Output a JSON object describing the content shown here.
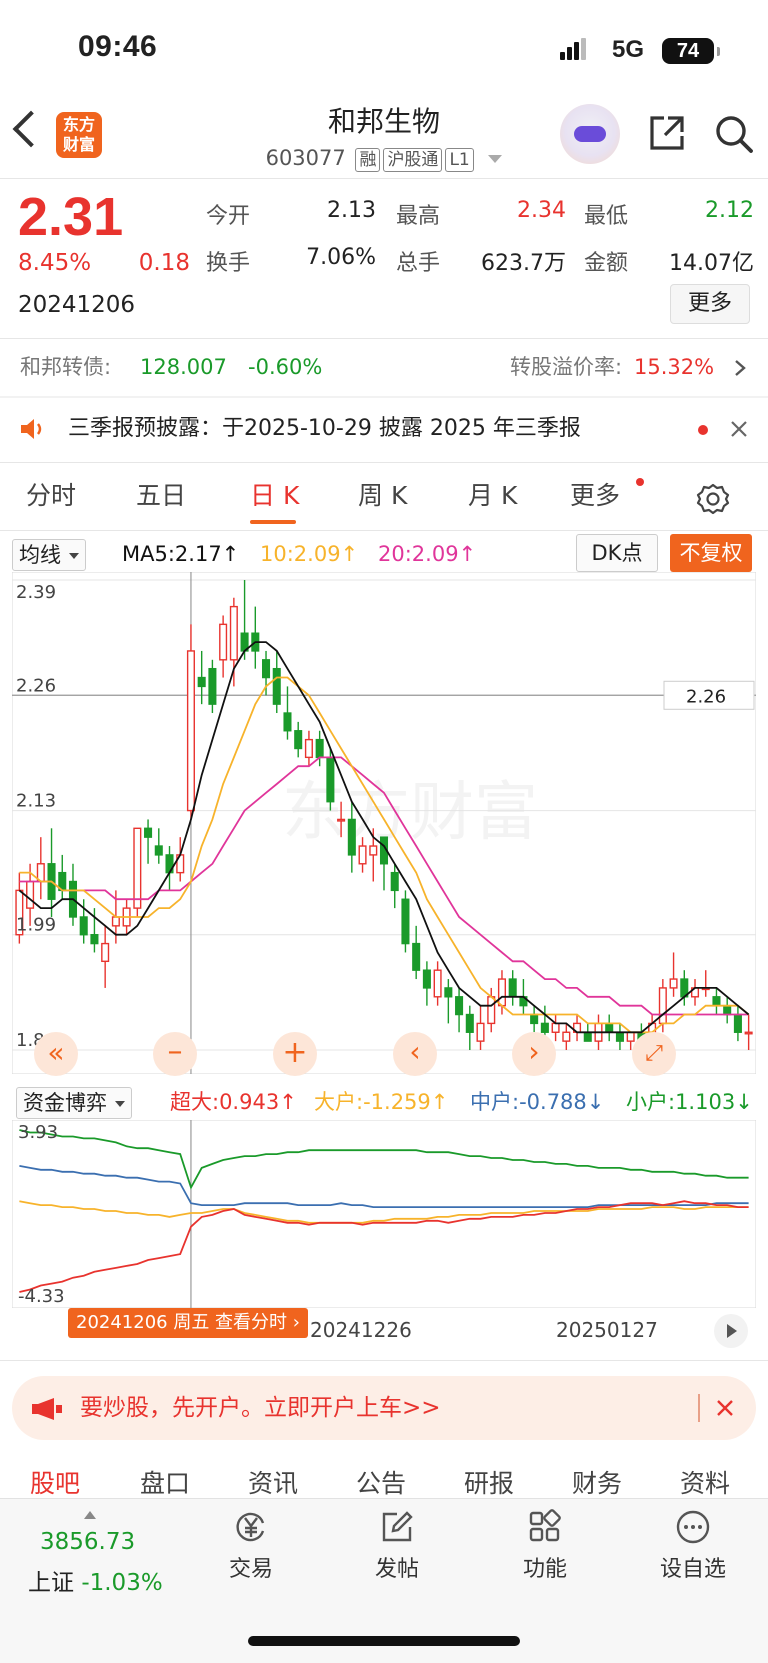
{
  "status_bar": {
    "time": "09:46",
    "network": "5G",
    "battery": "74"
  },
  "header": {
    "logo_text": "东方财富",
    "stock_name": "和邦生物",
    "stock_code": "603077",
    "tags": [
      "融",
      "沪股通",
      "L1"
    ]
  },
  "quote": {
    "price": "2.31",
    "change_pct": "8.45%",
    "change_amt": "0.18",
    "date": "20241206",
    "fields": [
      {
        "label": "今开",
        "value": "2.13",
        "color": "neutral"
      },
      {
        "label": "最高",
        "value": "2.34",
        "color": "red"
      },
      {
        "label": "最低",
        "value": "2.12",
        "color": "green"
      },
      {
        "label": "换手",
        "value": "7.06%",
        "color": "neutral"
      },
      {
        "label": "总手",
        "value": "623.7万",
        "color": "neutral"
      },
      {
        "label": "金额",
        "value": "14.07亿",
        "color": "neutral"
      }
    ],
    "more_label": "更多"
  },
  "bond": {
    "label": "和邦转债:",
    "price": "128.007",
    "change": "-0.60%",
    "premium_label": "转股溢价率:",
    "premium_value": "15.32%"
  },
  "notice": {
    "text": "三季报预披露：于2025-10-29 披露 2025 年三季报"
  },
  "chart_tabs": {
    "items": [
      "分时",
      "五日",
      "日 K",
      "周 K",
      "月 K",
      "更多"
    ],
    "active": "日 K"
  },
  "ma_bar": {
    "selector": "均线",
    "ma5": "MA5:2.17↑",
    "ma10": "10:2.09↑",
    "ma20": "20:2.09↑",
    "dk_label": "DK点",
    "fq_label": "不复权"
  },
  "kline_axis": {
    "labels": [
      "2.39",
      "2.26",
      "2.13",
      "1.99",
      "1.86"
    ],
    "crosshair_price": "2.26"
  },
  "fund_bar": {
    "selector": "资金博弈",
    "super": "超大:0.943↑",
    "large": "大户:-1.259↑",
    "medium": "中户:-0.788↓",
    "small": "小户:1.103↓"
  },
  "fund_axis": {
    "top": "3.93",
    "bottom": "-4.33"
  },
  "date_axis": {
    "labels": [
      "20241226",
      "20250127"
    ],
    "badge": "20241206 周五 查看分时"
  },
  "watermark": "东方财富",
  "colors": {
    "up": "#e8332e",
    "down": "#1a9a2a",
    "accent": "#f0641e",
    "ma5": "#111111",
    "ma10": "#f7b32b",
    "ma20": "#e0359a"
  },
  "chart_data": {
    "type": "candlestick",
    "ylim": [
      1.86,
      2.39
    ],
    "candles": [
      {
        "o": 1.99,
        "h": 2.06,
        "l": 1.98,
        "c": 2.04
      },
      {
        "o": 2.02,
        "h": 2.07,
        "l": 2.0,
        "c": 2.05
      },
      {
        "o": 2.05,
        "h": 2.1,
        "l": 2.03,
        "c": 2.07
      },
      {
        "o": 2.07,
        "h": 2.11,
        "l": 2.01,
        "c": 2.03
      },
      {
        "o": 2.06,
        "h": 2.08,
        "l": 2.03,
        "c": 2.04
      },
      {
        "o": 2.05,
        "h": 2.07,
        "l": 2.0,
        "c": 2.01
      },
      {
        "o": 2.01,
        "h": 2.03,
        "l": 1.98,
        "c": 1.99
      },
      {
        "o": 1.99,
        "h": 2.02,
        "l": 1.97,
        "c": 1.98
      },
      {
        "o": 1.96,
        "h": 2.0,
        "l": 1.93,
        "c": 1.98
      },
      {
        "o": 2.0,
        "h": 2.04,
        "l": 1.98,
        "c": 2.01
      },
      {
        "o": 2.0,
        "h": 2.03,
        "l": 1.99,
        "c": 2.02
      },
      {
        "o": 2.02,
        "h": 2.11,
        "l": 2.01,
        "c": 2.11
      },
      {
        "o": 2.11,
        "h": 2.12,
        "l": 2.07,
        "c": 2.1
      },
      {
        "o": 2.09,
        "h": 2.11,
        "l": 2.07,
        "c": 2.08
      },
      {
        "o": 2.08,
        "h": 2.09,
        "l": 2.04,
        "c": 2.06
      },
      {
        "o": 2.06,
        "h": 2.1,
        "l": 2.05,
        "c": 2.08
      },
      {
        "o": 2.13,
        "h": 2.34,
        "l": 2.12,
        "c": 2.31
      },
      {
        "o": 2.28,
        "h": 2.31,
        "l": 2.25,
        "c": 2.27
      },
      {
        "o": 2.29,
        "h": 2.3,
        "l": 2.24,
        "c": 2.25
      },
      {
        "o": 2.3,
        "h": 2.35,
        "l": 2.28,
        "c": 2.34
      },
      {
        "o": 2.3,
        "h": 2.37,
        "l": 2.27,
        "c": 2.36
      },
      {
        "o": 2.33,
        "h": 2.39,
        "l": 2.3,
        "c": 2.31
      },
      {
        "o": 2.33,
        "h": 2.36,
        "l": 2.29,
        "c": 2.31
      },
      {
        "o": 2.3,
        "h": 2.31,
        "l": 2.26,
        "c": 2.28
      },
      {
        "o": 2.29,
        "h": 2.31,
        "l": 2.24,
        "c": 2.25
      },
      {
        "o": 2.24,
        "h": 2.27,
        "l": 2.21,
        "c": 2.22
      },
      {
        "o": 2.22,
        "h": 2.23,
        "l": 2.19,
        "c": 2.2
      },
      {
        "o": 2.19,
        "h": 2.22,
        "l": 2.18,
        "c": 2.21
      },
      {
        "o": 2.21,
        "h": 2.22,
        "l": 2.18,
        "c": 2.19
      },
      {
        "o": 2.19,
        "h": 2.2,
        "l": 2.13,
        "c": 2.14
      },
      {
        "o": 2.12,
        "h": 2.14,
        "l": 2.1,
        "c": 2.12
      },
      {
        "o": 2.12,
        "h": 2.14,
        "l": 2.06,
        "c": 2.08
      },
      {
        "o": 2.07,
        "h": 2.1,
        "l": 2.06,
        "c": 2.09
      },
      {
        "o": 2.08,
        "h": 2.11,
        "l": 2.05,
        "c": 2.09
      },
      {
        "o": 2.1,
        "h": 2.1,
        "l": 2.04,
        "c": 2.07
      },
      {
        "o": 2.06,
        "h": 2.07,
        "l": 2.02,
        "c": 2.04
      },
      {
        "o": 2.03,
        "h": 2.04,
        "l": 1.97,
        "c": 1.98
      },
      {
        "o": 1.98,
        "h": 2.0,
        "l": 1.94,
        "c": 1.95
      },
      {
        "o": 1.95,
        "h": 1.96,
        "l": 1.91,
        "c": 1.93
      },
      {
        "o": 1.92,
        "h": 1.96,
        "l": 1.91,
        "c": 1.95
      },
      {
        "o": 1.93,
        "h": 1.94,
        "l": 1.89,
        "c": 1.92
      },
      {
        "o": 1.92,
        "h": 1.93,
        "l": 1.88,
        "c": 1.9
      },
      {
        "o": 1.9,
        "h": 1.91,
        "l": 1.86,
        "c": 1.88
      },
      {
        "o": 1.87,
        "h": 1.91,
        "l": 1.86,
        "c": 1.89
      },
      {
        "o": 1.89,
        "h": 1.93,
        "l": 1.88,
        "c": 1.92
      },
      {
        "o": 1.91,
        "h": 1.95,
        "l": 1.9,
        "c": 1.94
      },
      {
        "o": 1.94,
        "h": 1.95,
        "l": 1.91,
        "c": 1.92
      },
      {
        "o": 1.92,
        "h": 1.94,
        "l": 1.9,
        "c": 1.91
      },
      {
        "o": 1.9,
        "h": 1.91,
        "l": 1.88,
        "c": 1.89
      },
      {
        "o": 1.89,
        "h": 1.91,
        "l": 1.87,
        "c": 1.88
      },
      {
        "o": 1.88,
        "h": 1.9,
        "l": 1.87,
        "c": 1.89
      },
      {
        "o": 1.87,
        "h": 1.89,
        "l": 1.86,
        "c": 1.88
      },
      {
        "o": 1.88,
        "h": 1.9,
        "l": 1.87,
        "c": 1.89
      },
      {
        "o": 1.88,
        "h": 1.89,
        "l": 1.87,
        "c": 1.87
      },
      {
        "o": 1.87,
        "h": 1.9,
        "l": 1.86,
        "c": 1.89
      },
      {
        "o": 1.89,
        "h": 1.9,
        "l": 1.87,
        "c": 1.88
      },
      {
        "o": 1.88,
        "h": 1.89,
        "l": 1.86,
        "c": 1.87
      },
      {
        "o": 1.87,
        "h": 1.88,
        "l": 1.86,
        "c": 1.88
      },
      {
        "o": 1.88,
        "h": 1.89,
        "l": 1.86,
        "c": 1.87
      },
      {
        "o": 1.87,
        "h": 1.9,
        "l": 1.87,
        "c": 1.89
      },
      {
        "o": 1.89,
        "h": 1.94,
        "l": 1.88,
        "c": 1.93
      },
      {
        "o": 1.93,
        "h": 1.97,
        "l": 1.92,
        "c": 1.94
      },
      {
        "o": 1.94,
        "h": 1.95,
        "l": 1.91,
        "c": 1.92
      },
      {
        "o": 1.92,
        "h": 1.94,
        "l": 1.91,
        "c": 1.93
      },
      {
        "o": 1.93,
        "h": 1.95,
        "l": 1.92,
        "c": 1.93
      },
      {
        "o": 1.92,
        "h": 1.93,
        "l": 1.9,
        "c": 1.91
      },
      {
        "o": 1.91,
        "h": 1.92,
        "l": 1.89,
        "c": 1.9
      },
      {
        "o": 1.9,
        "h": 1.91,
        "l": 1.87,
        "c": 1.88
      },
      {
        "o": 1.88,
        "h": 1.9,
        "l": 1.86,
        "c": 1.88
      }
    ],
    "ma5": [
      2.04,
      2.03,
      2.02,
      2.02,
      2.03,
      2.03,
      2.02,
      2.01,
      2.0,
      1.99,
      1.99,
      2.0,
      2.02,
      2.04,
      2.06,
      2.08,
      2.12,
      2.17,
      2.21,
      2.25,
      2.29,
      2.31,
      2.32,
      2.32,
      2.31,
      2.29,
      2.27,
      2.25,
      2.23,
      2.2,
      2.17,
      2.14,
      2.12,
      2.1,
      2.09,
      2.07,
      2.05,
      2.03,
      2.0,
      1.97,
      1.95,
      1.93,
      1.92,
      1.91,
      1.91,
      1.92,
      1.92,
      1.92,
      1.91,
      1.9,
      1.89,
      1.89,
      1.88,
      1.88,
      1.88,
      1.88,
      1.88,
      1.88,
      1.88,
      1.89,
      1.9,
      1.91,
      1.92,
      1.93,
      1.93,
      1.93,
      1.92,
      1.91,
      1.9
    ],
    "ma10": [
      2.06,
      2.06,
      2.05,
      2.05,
      2.04,
      2.04,
      2.04,
      2.03,
      2.02,
      2.01,
      2.01,
      2.01,
      2.01,
      2.02,
      2.02,
      2.03,
      2.05,
      2.09,
      2.12,
      2.16,
      2.19,
      2.22,
      2.25,
      2.27,
      2.28,
      2.28,
      2.27,
      2.26,
      2.24,
      2.22,
      2.2,
      2.18,
      2.16,
      2.14,
      2.12,
      2.1,
      2.08,
      2.06,
      2.03,
      2.01,
      1.99,
      1.97,
      1.95,
      1.93,
      1.92,
      1.91,
      1.9,
      1.9,
      1.9,
      1.9,
      1.9,
      1.9,
      1.9,
      1.89,
      1.89,
      1.89,
      1.89,
      1.88,
      1.88,
      1.88,
      1.89,
      1.89,
      1.9,
      1.9,
      1.91,
      1.91,
      1.91,
      1.91,
      1.9
    ],
    "ma20": [
      2.05,
      2.05,
      2.05,
      2.05,
      2.04,
      2.04,
      2.04,
      2.04,
      2.04,
      2.03,
      2.03,
      2.03,
      2.03,
      2.04,
      2.04,
      2.04,
      2.05,
      2.06,
      2.07,
      2.09,
      2.11,
      2.13,
      2.14,
      2.15,
      2.16,
      2.17,
      2.18,
      2.18,
      2.19,
      2.19,
      2.19,
      2.18,
      2.17,
      2.16,
      2.15,
      2.13,
      2.11,
      2.09,
      2.07,
      2.05,
      2.03,
      2.01,
      2.0,
      1.99,
      1.98,
      1.97,
      1.96,
      1.96,
      1.95,
      1.94,
      1.94,
      1.93,
      1.93,
      1.92,
      1.92,
      1.92,
      1.91,
      1.91,
      1.91,
      1.9,
      1.9,
      1.9,
      1.9,
      1.9,
      1.9,
      1.9,
      1.9,
      1.9,
      1.9
    ],
    "fund_series": {
      "ylim": [
        -4.33,
        3.93
      ],
      "super": [
        -4.33,
        -4.2,
        -4.0,
        -3.9,
        -3.8,
        -3.6,
        -3.5,
        -3.3,
        -3.2,
        -3.1,
        -3.0,
        -2.9,
        -2.7,
        -2.6,
        -2.5,
        -2.4,
        -1.0,
        -0.5,
        -0.4,
        -0.2,
        -0.1,
        -0.4,
        -0.5,
        -0.6,
        -0.7,
        -0.8,
        -0.8,
        -0.9,
        -0.8,
        -0.8,
        -0.8,
        -0.8,
        -0.9,
        -0.8,
        -0.8,
        -0.8,
        -0.8,
        -0.8,
        -0.7,
        -0.7,
        -0.8,
        -0.7,
        -0.6,
        -0.6,
        -0.5,
        -0.5,
        -0.5,
        -0.4,
        -0.4,
        -0.3,
        -0.3,
        -0.2,
        -0.1,
        -0.1,
        0.0,
        0.0,
        0.1,
        0.2,
        0.2,
        0.2,
        0.1,
        0.2,
        0.3,
        0.2,
        0.2,
        0.1,
        0.1,
        0.0,
        0.0
      ],
      "large": [
        0.3,
        0.2,
        0.1,
        0.1,
        0.0,
        0.0,
        -0.1,
        -0.1,
        -0.2,
        -0.2,
        -0.3,
        -0.3,
        -0.4,
        -0.4,
        -0.5,
        -0.4,
        -0.3,
        -0.3,
        -0.2,
        -0.1,
        -0.1,
        -0.3,
        -0.4,
        -0.5,
        -0.6,
        -0.7,
        -0.7,
        -0.8,
        -0.8,
        -0.8,
        -0.8,
        -0.8,
        -0.8,
        -0.7,
        -0.7,
        -0.6,
        -0.6,
        -0.6,
        -0.6,
        -0.5,
        -0.5,
        -0.4,
        -0.4,
        -0.4,
        -0.3,
        -0.3,
        -0.3,
        -0.3,
        -0.2,
        -0.2,
        -0.2,
        -0.2,
        -0.2,
        -0.2,
        -0.1,
        -0.1,
        -0.1,
        -0.1,
        -0.1,
        0.0,
        0.0,
        0.0,
        -0.1,
        -0.1,
        0.0,
        0.0,
        0.0,
        0.0,
        0.0
      ],
      "medium": [
        2.1,
        2.0,
        1.9,
        1.9,
        1.8,
        1.8,
        1.7,
        1.7,
        1.6,
        1.6,
        1.5,
        1.5,
        1.4,
        1.3,
        1.3,
        1.2,
        0.2,
        0.1,
        0.1,
        0.1,
        0.1,
        0.2,
        0.2,
        0.2,
        0.2,
        0.2,
        0.1,
        0.1,
        0.1,
        0.1,
        0.2,
        0.1,
        0.1,
        0.0,
        0.0,
        0.0,
        0.0,
        0.0,
        0.0,
        0.0,
        0.0,
        0.0,
        0.0,
        0.0,
        0.0,
        0.0,
        0.0,
        0.0,
        0.0,
        0.0,
        0.0,
        0.0,
        0.0,
        0.0,
        0.1,
        0.1,
        0.1,
        0.1,
        0.1,
        0.1,
        0.1,
        0.1,
        0.1,
        0.1,
        0.1,
        0.2,
        0.2,
        0.2,
        0.2
      ],
      "small": [
        3.93,
        3.8,
        3.8,
        3.7,
        3.6,
        3.6,
        3.5,
        3.5,
        3.4,
        3.3,
        3.1,
        3.0,
        3.0,
        2.9,
        2.8,
        2.7,
        1.0,
        2.0,
        2.2,
        2.4,
        2.5,
        2.6,
        2.6,
        2.7,
        2.7,
        2.8,
        2.8,
        2.9,
        2.9,
        2.9,
        2.9,
        2.9,
        2.9,
        2.9,
        2.9,
        2.9,
        2.9,
        2.9,
        2.8,
        2.8,
        2.8,
        2.7,
        2.6,
        2.6,
        2.5,
        2.5,
        2.4,
        2.4,
        2.3,
        2.3,
        2.2,
        2.2,
        2.1,
        2.1,
        2.0,
        2.0,
        2.0,
        1.9,
        1.9,
        1.8,
        1.8,
        1.8,
        1.7,
        1.7,
        1.6,
        1.6,
        1.5,
        1.5,
        1.5
      ]
    }
  },
  "promo": {
    "text": "要炒股，先开户。立即开户上车>>"
  },
  "bottom_tabs": {
    "items": [
      "股吧",
      "盘口",
      "资讯",
      "公告",
      "研报",
      "财务",
      "资料"
    ],
    "active": "股吧"
  },
  "bottom_nav": {
    "index_value": "3856.73",
    "index_label": "上证",
    "index_change": "-1.03%",
    "items": [
      "交易",
      "发帖",
      "功能",
      "设自选"
    ]
  }
}
